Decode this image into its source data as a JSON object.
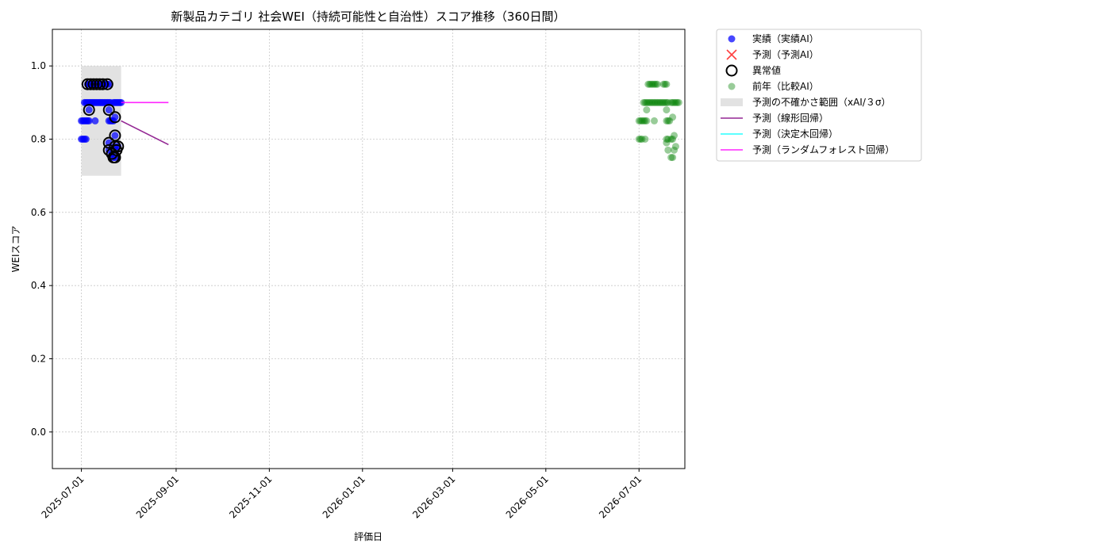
{
  "chart_data": {
    "type": "scatter",
    "title": "新製品カテゴリ 社会WEI（持続可能性と自治性）スコア推移（360日間）",
    "xlabel": "評価日",
    "ylabel": "WEIスコア",
    "xlim": [
      "2025-06-12",
      "2026-07-31"
    ],
    "ylim": [
      -0.1,
      1.1
    ],
    "x_ticks": [
      "2025-07-01",
      "2025-09-01",
      "2025-11-01",
      "2026-01-01",
      "2026-03-01",
      "2026-05-01",
      "2026-07-01"
    ],
    "y_ticks": [
      "0.0",
      "0.2",
      "0.4",
      "0.6",
      "0.8",
      "1.0"
    ],
    "grid": true,
    "legend_position": "outside-upper-right",
    "legend": [
      {
        "label": "実績（実績AI）",
        "marker": "circle",
        "color": "#0000ff"
      },
      {
        "label": "予測（予測AI）",
        "marker": "x",
        "color": "#ff0000"
      },
      {
        "label": "異常値",
        "marker": "open-circle",
        "color": "#000000"
      },
      {
        "label": "前年（比較AI）",
        "marker": "circle",
        "color": "#008000"
      },
      {
        "label": "予測の不確かさ範囲（xAI/３σ）",
        "marker": "band",
        "color": "#d3d3d3"
      },
      {
        "label": "予測（線形回帰）",
        "marker": "line",
        "color": "#800080"
      },
      {
        "label": "予測（決定木回帰）",
        "marker": "line",
        "color": "#00ffff"
      },
      {
        "label": "予測（ランダムフォレスト回帰）",
        "marker": "line",
        "color": "#ff00ff"
      }
    ],
    "series": [
      {
        "name": "実績（実績AI）",
        "kind": "scatter",
        "color": "#0000ff",
        "points": [
          [
            "2025-07-01",
            0.8
          ],
          [
            "2025-07-02",
            0.8
          ],
          [
            "2025-07-03",
            0.8
          ],
          [
            "2025-07-04",
            0.8
          ],
          [
            "2025-07-01",
            0.85
          ],
          [
            "2025-07-02",
            0.85
          ],
          [
            "2025-07-03",
            0.85
          ],
          [
            "2025-07-04",
            0.85
          ],
          [
            "2025-07-05",
            0.85
          ],
          [
            "2025-07-06",
            0.85
          ],
          [
            "2025-07-10",
            0.85
          ],
          [
            "2025-07-03",
            0.9
          ],
          [
            "2025-07-04",
            0.9
          ],
          [
            "2025-07-05",
            0.9
          ],
          [
            "2025-07-06",
            0.9
          ],
          [
            "2025-07-07",
            0.9
          ],
          [
            "2025-07-08",
            0.9
          ],
          [
            "2025-07-09",
            0.9
          ],
          [
            "2025-07-10",
            0.9
          ],
          [
            "2025-07-11",
            0.9
          ],
          [
            "2025-07-12",
            0.9
          ],
          [
            "2025-07-13",
            0.9
          ],
          [
            "2025-07-14",
            0.9
          ],
          [
            "2025-07-15",
            0.9
          ],
          [
            "2025-07-16",
            0.9
          ],
          [
            "2025-07-17",
            0.9
          ],
          [
            "2025-07-18",
            0.9
          ],
          [
            "2025-07-19",
            0.9
          ],
          [
            "2025-07-20",
            0.9
          ],
          [
            "2025-07-22",
            0.9
          ],
          [
            "2025-07-23",
            0.9
          ],
          [
            "2025-07-24",
            0.9
          ],
          [
            "2025-07-25",
            0.9
          ],
          [
            "2025-07-26",
            0.9
          ],
          [
            "2025-07-27",
            0.9
          ],
          [
            "2025-07-05",
            0.95
          ],
          [
            "2025-07-06",
            0.95
          ],
          [
            "2025-07-07",
            0.95
          ],
          [
            "2025-07-08",
            0.95
          ],
          [
            "2025-07-09",
            0.95
          ],
          [
            "2025-07-10",
            0.95
          ],
          [
            "2025-07-11",
            0.95
          ],
          [
            "2025-07-12",
            0.95
          ],
          [
            "2025-07-13",
            0.95
          ],
          [
            "2025-07-14",
            0.95
          ],
          [
            "2025-07-15",
            0.95
          ],
          [
            "2025-07-16",
            0.95
          ],
          [
            "2025-07-17",
            0.95
          ],
          [
            "2025-07-18",
            0.95
          ],
          [
            "2025-07-19",
            0.95
          ],
          [
            "2025-07-06",
            0.88
          ],
          [
            "2025-07-19",
            0.88
          ],
          [
            "2025-07-19",
            0.85
          ],
          [
            "2025-07-20",
            0.85
          ],
          [
            "2025-07-21",
            0.85
          ],
          [
            "2025-07-22",
            0.85
          ],
          [
            "2025-07-23",
            0.86
          ],
          [
            "2025-07-19",
            0.79
          ],
          [
            "2025-07-19",
            0.77
          ],
          [
            "2025-07-21",
            0.76
          ],
          [
            "2025-07-22",
            0.75
          ],
          [
            "2025-07-23",
            0.75
          ],
          [
            "2025-07-23",
            0.78
          ],
          [
            "2025-07-24",
            0.77
          ],
          [
            "2025-07-25",
            0.78
          ],
          [
            "2025-07-23",
            0.81
          ]
        ]
      },
      {
        "name": "異常値",
        "kind": "open-circle",
        "color": "#000000",
        "points": [
          [
            "2025-07-05",
            0.95
          ],
          [
            "2025-07-07",
            0.95
          ],
          [
            "2025-07-09",
            0.95
          ],
          [
            "2025-07-11",
            0.95
          ],
          [
            "2025-07-13",
            0.95
          ],
          [
            "2025-07-15",
            0.95
          ],
          [
            "2025-07-18",
            0.95
          ],
          [
            "2025-07-06",
            0.88
          ],
          [
            "2025-07-19",
            0.88
          ],
          [
            "2025-07-23",
            0.86
          ],
          [
            "2025-07-23",
            0.81
          ],
          [
            "2025-07-19",
            0.79
          ],
          [
            "2025-07-19",
            0.77
          ],
          [
            "2025-07-21",
            0.76
          ],
          [
            "2025-07-22",
            0.75
          ],
          [
            "2025-07-23",
            0.75
          ],
          [
            "2025-07-24",
            0.77
          ],
          [
            "2025-07-25",
            0.78
          ],
          [
            "2025-07-23",
            0.78
          ]
        ]
      },
      {
        "name": "前年（比較AI）",
        "kind": "scatter",
        "color": "#008000",
        "points": [
          [
            "2026-07-01",
            0.8
          ],
          [
            "2026-07-02",
            0.8
          ],
          [
            "2026-07-03",
            0.8
          ],
          [
            "2026-07-05",
            0.8
          ],
          [
            "2026-07-01",
            0.85
          ],
          [
            "2026-07-02",
            0.85
          ],
          [
            "2026-07-03",
            0.85
          ],
          [
            "2026-07-04",
            0.85
          ],
          [
            "2026-07-05",
            0.85
          ],
          [
            "2026-07-06",
            0.85
          ],
          [
            "2026-07-11",
            0.85
          ],
          [
            "2026-07-04",
            0.9
          ],
          [
            "2026-07-05",
            0.9
          ],
          [
            "2026-07-06",
            0.9
          ],
          [
            "2026-07-07",
            0.9
          ],
          [
            "2026-07-08",
            0.9
          ],
          [
            "2026-07-09",
            0.9
          ],
          [
            "2026-07-10",
            0.9
          ],
          [
            "2026-07-11",
            0.9
          ],
          [
            "2026-07-12",
            0.9
          ],
          [
            "2026-07-13",
            0.9
          ],
          [
            "2026-07-14",
            0.9
          ],
          [
            "2026-07-15",
            0.9
          ],
          [
            "2026-07-16",
            0.9
          ],
          [
            "2026-07-17",
            0.9
          ],
          [
            "2026-07-18",
            0.9
          ],
          [
            "2026-07-19",
            0.9
          ],
          [
            "2026-07-20",
            0.9
          ],
          [
            "2026-07-22",
            0.9
          ],
          [
            "2026-07-23",
            0.9
          ],
          [
            "2026-07-24",
            0.9
          ],
          [
            "2026-07-25",
            0.9
          ],
          [
            "2026-07-26",
            0.9
          ],
          [
            "2026-07-27",
            0.9
          ],
          [
            "2026-07-07",
            0.95
          ],
          [
            "2026-07-08",
            0.95
          ],
          [
            "2026-07-09",
            0.95
          ],
          [
            "2026-07-10",
            0.95
          ],
          [
            "2026-07-11",
            0.95
          ],
          [
            "2026-07-12",
            0.95
          ],
          [
            "2026-07-13",
            0.95
          ],
          [
            "2026-07-17",
            0.95
          ],
          [
            "2026-07-18",
            0.95
          ],
          [
            "2026-07-19",
            0.95
          ],
          [
            "2026-07-06",
            0.88
          ],
          [
            "2026-07-19",
            0.88
          ],
          [
            "2026-07-19",
            0.85
          ],
          [
            "2026-07-20",
            0.85
          ],
          [
            "2026-07-21",
            0.85
          ],
          [
            "2026-07-23",
            0.86
          ],
          [
            "2026-07-19",
            0.8
          ],
          [
            "2026-07-20",
            0.8
          ],
          [
            "2026-07-22",
            0.8
          ],
          [
            "2026-07-23",
            0.8
          ],
          [
            "2026-07-19",
            0.79
          ],
          [
            "2026-07-20",
            0.77
          ],
          [
            "2026-07-22",
            0.75
          ],
          [
            "2026-07-23",
            0.75
          ],
          [
            "2026-07-24",
            0.77
          ],
          [
            "2026-07-25",
            0.78
          ],
          [
            "2026-07-24",
            0.81
          ]
        ]
      },
      {
        "name": "予測の不確かさ範囲（xAI/３σ）",
        "kind": "band",
        "color": "#d3d3d3",
        "x_range": [
          "2025-07-01",
          "2025-07-27"
        ],
        "y_range": [
          0.7,
          1.0
        ]
      },
      {
        "name": "予測（線形回帰）",
        "kind": "line",
        "color": "#800080",
        "points": [
          [
            "2025-07-27",
            0.85
          ],
          [
            "2025-08-27",
            0.785
          ]
        ]
      },
      {
        "name": "予測（ランダムフォレスト回帰）",
        "kind": "line",
        "color": "#ff00ff",
        "points": [
          [
            "2025-07-27",
            0.9
          ],
          [
            "2025-08-27",
            0.9
          ]
        ]
      }
    ]
  }
}
